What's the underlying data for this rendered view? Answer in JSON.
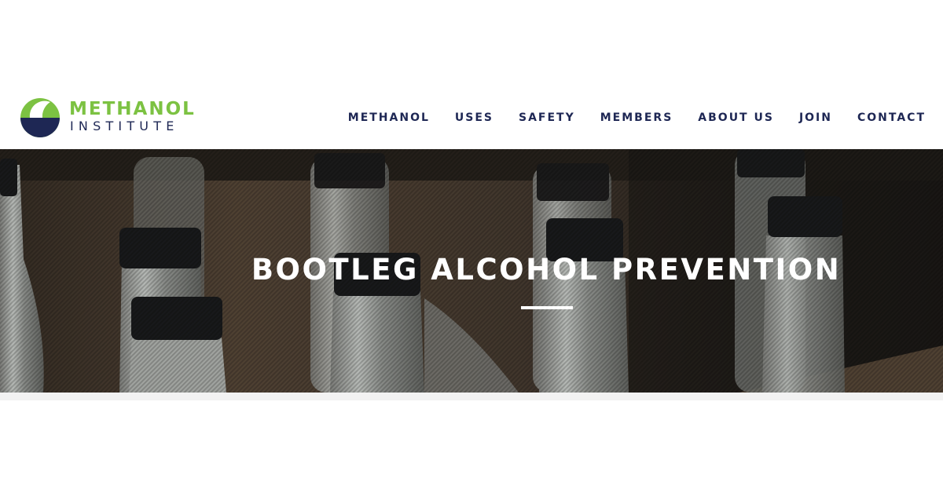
{
  "logo": {
    "line1": "METHANOL",
    "line2": "INSTITUTE"
  },
  "nav": {
    "items": [
      "METHANOL",
      "USES",
      "SAFETY",
      "MEMBERS",
      "ABOUT US",
      "JOIN",
      "CONTACT"
    ]
  },
  "hero": {
    "title": "BOOTLEG ALCOHOL PREVENTION"
  },
  "colors": {
    "brand_green": "#7cc242",
    "brand_navy": "#1e2754",
    "hero_text": "#ffffff"
  },
  "icons": {
    "logo_mark": "methanol-institute-logo-icon"
  }
}
